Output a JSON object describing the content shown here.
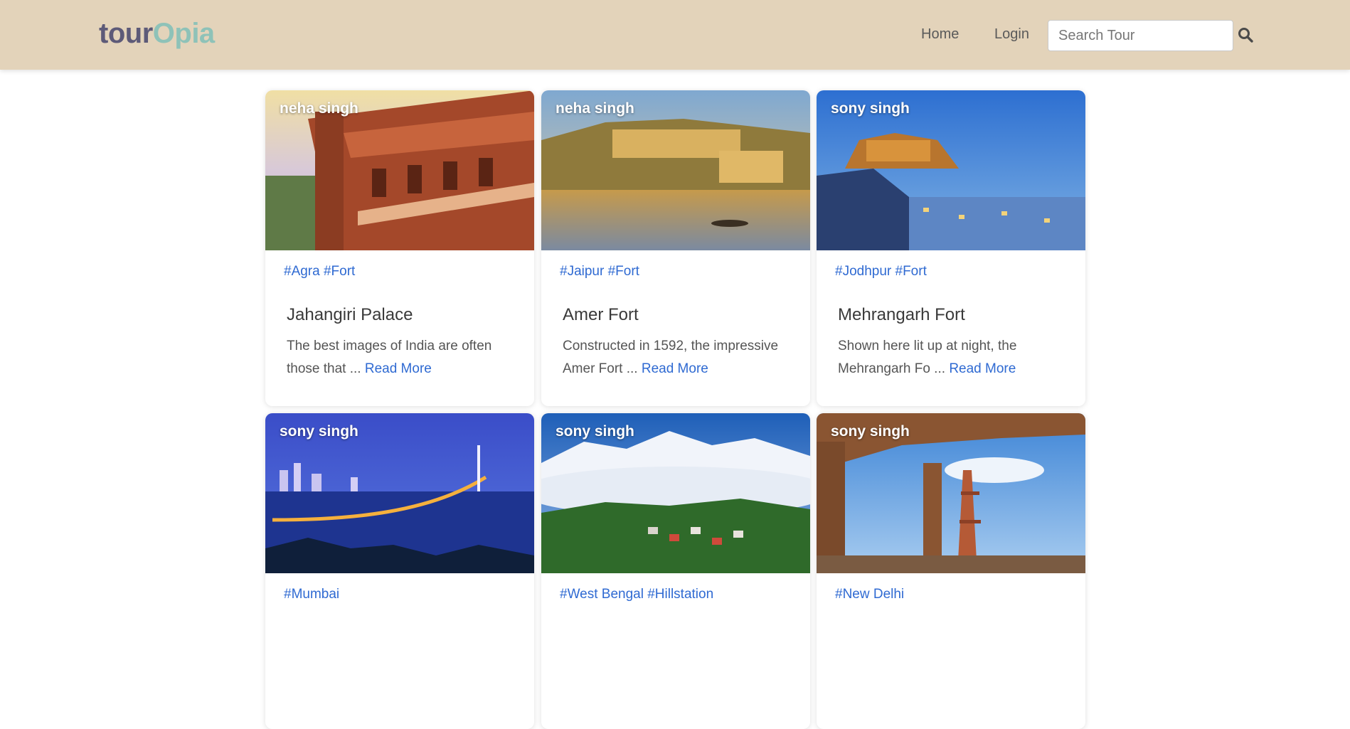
{
  "brand": {
    "part1": "tour",
    "part2": "Opia"
  },
  "nav": {
    "home": "Home",
    "login": "Login"
  },
  "search": {
    "placeholder": "Search Tour",
    "value": ""
  },
  "icons": {
    "search": "search-icon"
  },
  "colors": {
    "navbar": "#e3d3ba",
    "brand_dark": "#5d5a78",
    "brand_light": "#8ec2b8",
    "link": "#2f6ad2"
  },
  "cards": [
    {
      "author": "neha singh",
      "tags": "#Agra #Fort",
      "title": "Jahangiri Palace",
      "excerpt": "The best images of India are often those that ...",
      "read_more": "Read More"
    },
    {
      "author": "neha singh",
      "tags": "#Jaipur #Fort",
      "title": "Amer Fort",
      "excerpt": "Constructed in 1592, the impressive Amer Fort ...",
      "read_more": "Read More"
    },
    {
      "author": "sony singh",
      "tags": "#Jodhpur #Fort",
      "title": "Mehrangarh Fort",
      "excerpt": "Shown here lit up at night, the Mehrangarh Fo ...",
      "read_more": "Read More"
    },
    {
      "author": "sony singh",
      "tags": "#Mumbai",
      "title": "",
      "excerpt": "",
      "read_more": ""
    },
    {
      "author": "sony singh",
      "tags": "#West Bengal #Hillstation",
      "title": "",
      "excerpt": "",
      "read_more": ""
    },
    {
      "author": "sony singh",
      "tags": "#New Delhi",
      "title": "",
      "excerpt": "",
      "read_more": ""
    }
  ]
}
